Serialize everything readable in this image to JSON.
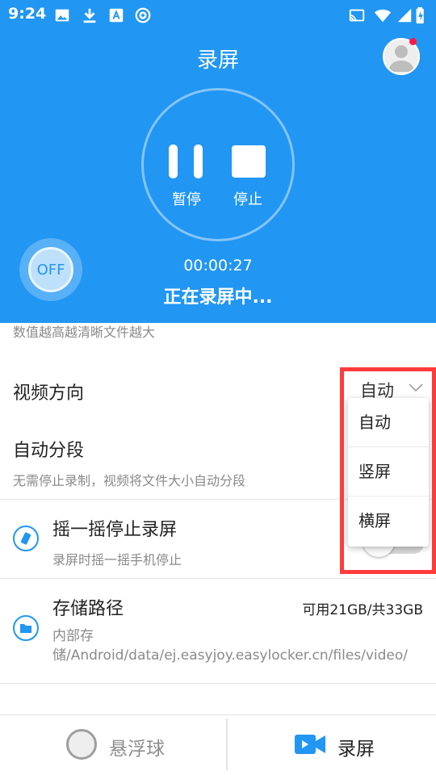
{
  "status_bar": {
    "time": "9:24",
    "icons": [
      "image-icon",
      "download-icon",
      "a-badge-icon",
      "circle-plus-icon",
      "cast-icon",
      "wifi-icon",
      "signal-icon",
      "battery-charging-icon"
    ]
  },
  "header": {
    "title": "录屏",
    "pause_label": "暂停",
    "stop_label": "停止",
    "timer": "00:00:27",
    "recording_status": "正在录屏中...",
    "floating_toggle_label": "OFF"
  },
  "settings": {
    "quality_hint": "数值越高越清晰文件越大",
    "orientation": {
      "title": "视频方向",
      "value": "自动"
    },
    "auto_segment": {
      "title": "自动分段",
      "hint": "无需停止录制，视频将文件大小自动分段"
    },
    "shake_stop": {
      "title": "摇一摇停止录屏",
      "hint": "录屏时摇一摇手机停止"
    },
    "storage": {
      "title": "存储路径",
      "free": "可用21GB/共33GB",
      "path": "内部存储/Android/data/ej.easyjoy.easylocker.cn/files/video/"
    }
  },
  "orientation_dropdown": {
    "options": [
      "自动",
      "竖屏",
      "横屏"
    ]
  },
  "bottom_nav": {
    "float_ball_label": "悬浮球",
    "record_label": "录屏"
  },
  "colors": {
    "primary": "#2196f3",
    "highlight_border": "#ff3b3b",
    "notification_dot": "#ff1744"
  }
}
